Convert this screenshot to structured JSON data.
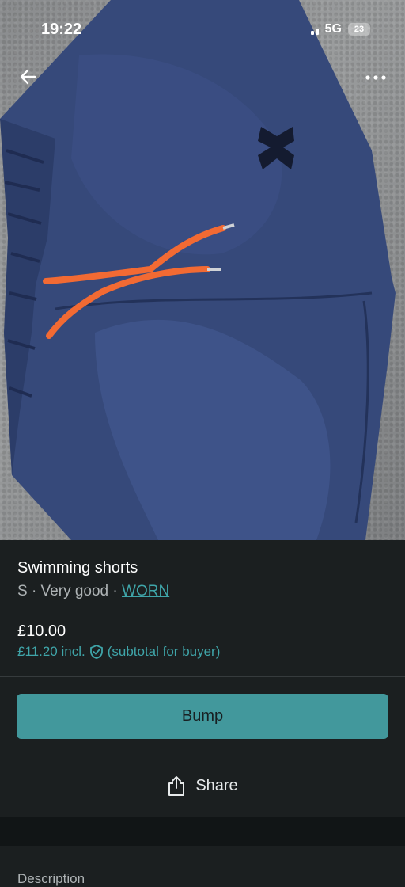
{
  "status_bar": {
    "time": "19:22",
    "network": "5G",
    "battery": "23"
  },
  "nav": {
    "back_icon": "arrow-left-icon",
    "more_icon": "more-horizontal-icon"
  },
  "listing": {
    "title": "Swimming shorts",
    "size_condition": "S · Very good · ",
    "brand": "WORN",
    "price": "£10.00",
    "price_incl": "£11.20 incl.",
    "price_incl_note": "(subtotal for buyer)",
    "protection_icon": "shield-check-icon"
  },
  "actions": {
    "bump_label": "Bump",
    "share_label": "Share",
    "share_icon": "share-icon"
  },
  "description": {
    "label": "Description"
  },
  "colors": {
    "accent": "#42989c",
    "link": "#3fa5a9",
    "background": "#1b1f20"
  }
}
